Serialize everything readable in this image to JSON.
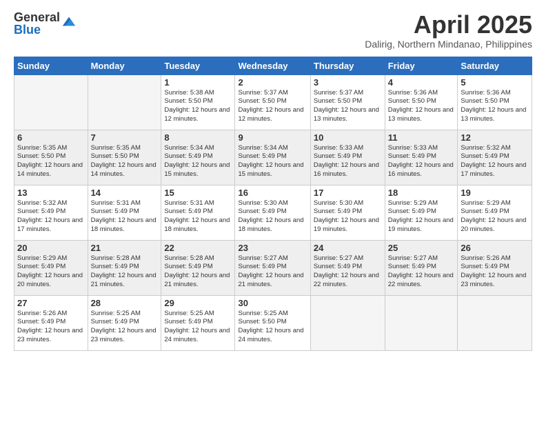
{
  "logo": {
    "general": "General",
    "blue": "Blue"
  },
  "title": "April 2025",
  "location": "Dalirig, Northern Mindanao, Philippines",
  "weekdays": [
    "Sunday",
    "Monday",
    "Tuesday",
    "Wednesday",
    "Thursday",
    "Friday",
    "Saturday"
  ],
  "weeks": [
    [
      {
        "day": "",
        "info": ""
      },
      {
        "day": "",
        "info": ""
      },
      {
        "day": "1",
        "info": "Sunrise: 5:38 AM\nSunset: 5:50 PM\nDaylight: 12 hours and 12 minutes."
      },
      {
        "day": "2",
        "info": "Sunrise: 5:37 AM\nSunset: 5:50 PM\nDaylight: 12 hours and 12 minutes."
      },
      {
        "day": "3",
        "info": "Sunrise: 5:37 AM\nSunset: 5:50 PM\nDaylight: 12 hours and 13 minutes."
      },
      {
        "day": "4",
        "info": "Sunrise: 5:36 AM\nSunset: 5:50 PM\nDaylight: 12 hours and 13 minutes."
      },
      {
        "day": "5",
        "info": "Sunrise: 5:36 AM\nSunset: 5:50 PM\nDaylight: 12 hours and 13 minutes."
      }
    ],
    [
      {
        "day": "6",
        "info": "Sunrise: 5:35 AM\nSunset: 5:50 PM\nDaylight: 12 hours and 14 minutes."
      },
      {
        "day": "7",
        "info": "Sunrise: 5:35 AM\nSunset: 5:50 PM\nDaylight: 12 hours and 14 minutes."
      },
      {
        "day": "8",
        "info": "Sunrise: 5:34 AM\nSunset: 5:49 PM\nDaylight: 12 hours and 15 minutes."
      },
      {
        "day": "9",
        "info": "Sunrise: 5:34 AM\nSunset: 5:49 PM\nDaylight: 12 hours and 15 minutes."
      },
      {
        "day": "10",
        "info": "Sunrise: 5:33 AM\nSunset: 5:49 PM\nDaylight: 12 hours and 16 minutes."
      },
      {
        "day": "11",
        "info": "Sunrise: 5:33 AM\nSunset: 5:49 PM\nDaylight: 12 hours and 16 minutes."
      },
      {
        "day": "12",
        "info": "Sunrise: 5:32 AM\nSunset: 5:49 PM\nDaylight: 12 hours and 17 minutes."
      }
    ],
    [
      {
        "day": "13",
        "info": "Sunrise: 5:32 AM\nSunset: 5:49 PM\nDaylight: 12 hours and 17 minutes."
      },
      {
        "day": "14",
        "info": "Sunrise: 5:31 AM\nSunset: 5:49 PM\nDaylight: 12 hours and 18 minutes."
      },
      {
        "day": "15",
        "info": "Sunrise: 5:31 AM\nSunset: 5:49 PM\nDaylight: 12 hours and 18 minutes."
      },
      {
        "day": "16",
        "info": "Sunrise: 5:30 AM\nSunset: 5:49 PM\nDaylight: 12 hours and 18 minutes."
      },
      {
        "day": "17",
        "info": "Sunrise: 5:30 AM\nSunset: 5:49 PM\nDaylight: 12 hours and 19 minutes."
      },
      {
        "day": "18",
        "info": "Sunrise: 5:29 AM\nSunset: 5:49 PM\nDaylight: 12 hours and 19 minutes."
      },
      {
        "day": "19",
        "info": "Sunrise: 5:29 AM\nSunset: 5:49 PM\nDaylight: 12 hours and 20 minutes."
      }
    ],
    [
      {
        "day": "20",
        "info": "Sunrise: 5:29 AM\nSunset: 5:49 PM\nDaylight: 12 hours and 20 minutes."
      },
      {
        "day": "21",
        "info": "Sunrise: 5:28 AM\nSunset: 5:49 PM\nDaylight: 12 hours and 21 minutes."
      },
      {
        "day": "22",
        "info": "Sunrise: 5:28 AM\nSunset: 5:49 PM\nDaylight: 12 hours and 21 minutes."
      },
      {
        "day": "23",
        "info": "Sunrise: 5:27 AM\nSunset: 5:49 PM\nDaylight: 12 hours and 21 minutes."
      },
      {
        "day": "24",
        "info": "Sunrise: 5:27 AM\nSunset: 5:49 PM\nDaylight: 12 hours and 22 minutes."
      },
      {
        "day": "25",
        "info": "Sunrise: 5:27 AM\nSunset: 5:49 PM\nDaylight: 12 hours and 22 minutes."
      },
      {
        "day": "26",
        "info": "Sunrise: 5:26 AM\nSunset: 5:49 PM\nDaylight: 12 hours and 23 minutes."
      }
    ],
    [
      {
        "day": "27",
        "info": "Sunrise: 5:26 AM\nSunset: 5:49 PM\nDaylight: 12 hours and 23 minutes."
      },
      {
        "day": "28",
        "info": "Sunrise: 5:25 AM\nSunset: 5:49 PM\nDaylight: 12 hours and 23 minutes."
      },
      {
        "day": "29",
        "info": "Sunrise: 5:25 AM\nSunset: 5:49 PM\nDaylight: 12 hours and 24 minutes."
      },
      {
        "day": "30",
        "info": "Sunrise: 5:25 AM\nSunset: 5:50 PM\nDaylight: 12 hours and 24 minutes."
      },
      {
        "day": "",
        "info": ""
      },
      {
        "day": "",
        "info": ""
      },
      {
        "day": "",
        "info": ""
      }
    ]
  ]
}
